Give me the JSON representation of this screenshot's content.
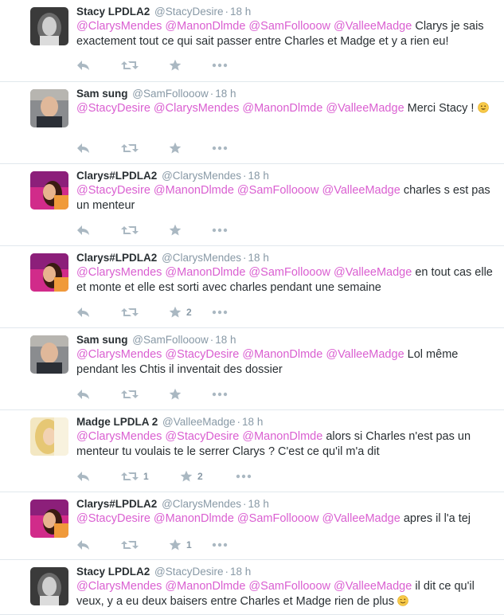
{
  "tweets": [
    {
      "fullname": "Stacy LPDLA2",
      "username": "@StacyDesire",
      "time": "18 h",
      "avatar": "stacy",
      "parts": [
        {
          "t": "@ClarysMendes",
          "m": true
        },
        {
          "t": " "
        },
        {
          "t": "@ManonDlmde",
          "m": true
        },
        {
          "t": " "
        },
        {
          "t": "@SamFollooow",
          "m": true
        },
        {
          "t": " "
        },
        {
          "t": "@ValleeMadge",
          "m": true
        },
        {
          "t": " Clarys je sais exactement tout ce qui sait passer entre Charles et Madge et y a rien eu!"
        }
      ],
      "retweets": "",
      "favorites": ""
    },
    {
      "fullname": "Sam sung",
      "username": "@SamFollooow",
      "time": "18 h",
      "avatar": "sam",
      "parts": [
        {
          "t": "@StacyDesire",
          "m": true
        },
        {
          "t": " "
        },
        {
          "t": "@ClarysMendes",
          "m": true
        },
        {
          "t": " "
        },
        {
          "t": "@ManonDlmde",
          "m": true
        },
        {
          "t": " "
        },
        {
          "t": "@ValleeMadge",
          "m": true
        },
        {
          "t": " Merci Stacy ! "
        },
        {
          "emoji": "smile-emoji"
        }
      ],
      "retweets": "",
      "favorites": ""
    },
    {
      "fullname": "Clarys#LPDLA2",
      "username": "@ClarysMendes",
      "time": "18 h",
      "avatar": "clarys",
      "parts": [
        {
          "t": "@StacyDesire",
          "m": true
        },
        {
          "t": " "
        },
        {
          "t": "@ManonDlmde",
          "m": true
        },
        {
          "t": " "
        },
        {
          "t": "@SamFollooow",
          "m": true
        },
        {
          "t": " "
        },
        {
          "t": "@ValleeMadge",
          "m": true
        },
        {
          "t": " charles s est pas un menteur"
        }
      ],
      "retweets": "",
      "favorites": ""
    },
    {
      "fullname": "Clarys#LPDLA2",
      "username": "@ClarysMendes",
      "time": "18 h",
      "avatar": "clarys",
      "parts": [
        {
          "t": "@ClarysMendes",
          "m": true
        },
        {
          "t": " "
        },
        {
          "t": "@ManonDlmde",
          "m": true
        },
        {
          "t": " "
        },
        {
          "t": "@SamFollooow",
          "m": true
        },
        {
          "t": " "
        },
        {
          "t": "@ValleeMadge",
          "m": true
        },
        {
          "t": " en tout cas elle et monte et elle est sorti avec charles pendant une semaine"
        }
      ],
      "retweets": "",
      "favorites": "2"
    },
    {
      "fullname": "Sam sung",
      "username": "@SamFollooow",
      "time": "18 h",
      "avatar": "sam",
      "parts": [
        {
          "t": "@ClarysMendes",
          "m": true
        },
        {
          "t": " "
        },
        {
          "t": "@StacyDesire",
          "m": true
        },
        {
          "t": " "
        },
        {
          "t": "@ManonDlmde",
          "m": true
        },
        {
          "t": " "
        },
        {
          "t": "@ValleeMadge",
          "m": true
        },
        {
          "t": " Lol même pendant les Chtis il inventait des dossier"
        }
      ],
      "retweets": "",
      "favorites": ""
    },
    {
      "fullname": "Madge LPDLA 2",
      "username": "@ValleeMadge",
      "time": "18 h",
      "avatar": "madge",
      "parts": [
        {
          "t": "@ClarysMendes",
          "m": true
        },
        {
          "t": " "
        },
        {
          "t": "@StacyDesire",
          "m": true
        },
        {
          "t": " "
        },
        {
          "t": "@ManonDlmde",
          "m": true
        },
        {
          "t": " alors si Charles n'est pas un menteur tu voulais te le serrer Clarys ? C'est ce qu'il m'a dit"
        }
      ],
      "retweets": "1",
      "favorites": "2"
    },
    {
      "fullname": "Clarys#LPDLA2",
      "username": "@ClarysMendes",
      "time": "18 h",
      "avatar": "clarys",
      "parts": [
        {
          "t": "@StacyDesire",
          "m": true
        },
        {
          "t": " "
        },
        {
          "t": "@ManonDlmde",
          "m": true
        },
        {
          "t": " "
        },
        {
          "t": "@SamFollooow",
          "m": true
        },
        {
          "t": " "
        },
        {
          "t": "@ValleeMadge",
          "m": true
        },
        {
          "t": " apres il l'a tej"
        }
      ],
      "retweets": "",
      "favorites": "1"
    },
    {
      "fullname": "Stacy LPDLA2",
      "username": "@StacyDesire",
      "time": "18 h",
      "avatar": "stacy",
      "parts": [
        {
          "t": "@ClarysMendes",
          "m": true
        },
        {
          "t": " "
        },
        {
          "t": "@ManonDlmde",
          "m": true
        },
        {
          "t": " "
        },
        {
          "t": "@SamFollooow",
          "m": true
        },
        {
          "t": " "
        },
        {
          "t": "@ValleeMadge",
          "m": true
        },
        {
          "t": " il dit ce qu'il veux, y a eu deux baisers entre Charles et Madge rien de plus "
        },
        {
          "emoji": "wink-emoji"
        }
      ],
      "retweets": "",
      "favorites": ""
    }
  ],
  "colors": {
    "mention": "#da5fd1",
    "action_icon": "#aab8c2",
    "meta_text": "#8899a6",
    "divider": "#e1e8ed"
  },
  "icons": {
    "reply": "reply-icon",
    "retweet": "retweet-icon",
    "favorite": "star-icon",
    "more": "more-icon"
  }
}
